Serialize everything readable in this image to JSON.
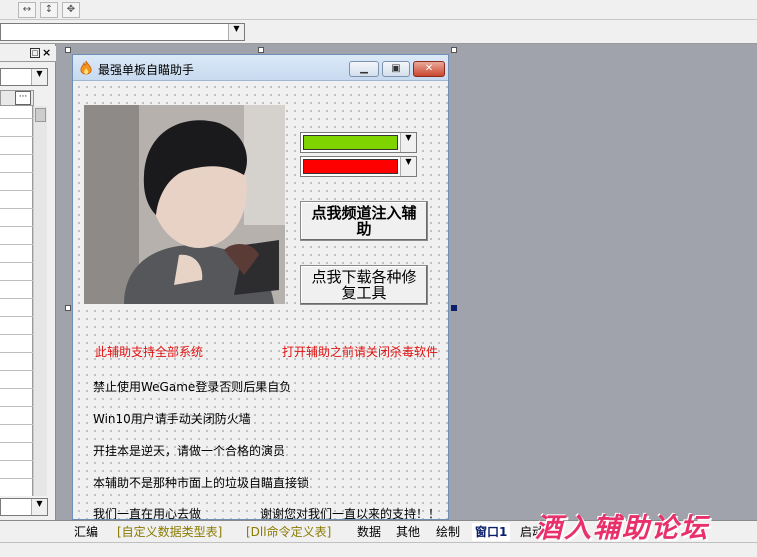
{
  "window": {
    "title": "最强单板自瞄助手",
    "minimize_icon": "minimize-icon",
    "maximize_icon": "maximize-icon",
    "close_icon": "close-icon"
  },
  "colors": {
    "combo_green": "#7fd400",
    "combo_red": "#ff0000",
    "warning_red": "#e01010",
    "watermark": "#e8306a"
  },
  "buttons": {
    "inject": "点我频道注入辅助",
    "download_repair": "点我下载各种修复工具"
  },
  "notices": {
    "supports_all_systems": "此辅助支持全部系统",
    "close_antivirus": "打开辅助之前请关闭杀毒软件"
  },
  "instructions": [
    "禁止使用WeGame登录否则后果自负",
    "Win10用户请手动关闭防火墙",
    "开挂本是逆天，请做一个合格的演员",
    "本辅助不是那种市面上的垃圾自瞄直接锁",
    "我们一直在用心去做"
  ],
  "thanks": "谢谢您对我们一直以来的支持！！",
  "tabs": [
    "汇编",
    "[自定义数据类型表]",
    "[Dll命令定义表]",
    "数据",
    "其他",
    "绘制",
    "窗口1",
    "启动"
  ],
  "active_tab": "窗口1",
  "watermark": "酒入辅助论坛",
  "toolbar_icons": [
    "resize-width-icon",
    "resize-height-icon",
    "move-icon"
  ],
  "panel_icons": [
    "pin-icon",
    "panel-close-icon",
    "ellipsis-icon"
  ]
}
